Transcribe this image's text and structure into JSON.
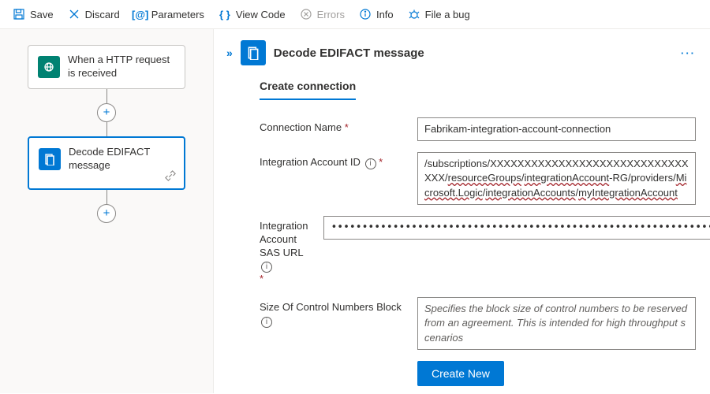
{
  "toolbar": {
    "save": "Save",
    "discard": "Discard",
    "parameters": "Parameters",
    "viewCode": "View Code",
    "errors": "Errors",
    "info": "Info",
    "fileBug": "File a bug"
  },
  "designer": {
    "trigger": {
      "label": "When a HTTP request is received"
    },
    "action": {
      "label": "Decode EDIFACT message"
    }
  },
  "panel": {
    "title": "Decode EDIFACT message",
    "menu": "···",
    "collapse": "»",
    "sectionTitle": "Create connection",
    "fields": {
      "connectionName": {
        "label": "Connection Name",
        "value": "Fabrikam-integration-account-connection"
      },
      "integrationAccountId": {
        "label": "Integration Account ID",
        "value": "/subscriptions/XXXXXXXXXXXXXXXXXXXXXXXXXXXXXXXX/resourceGroups/integrationAccount-RG/providers/Microsoft.Logic/integrationAccounts/myIntegrationAccount"
      },
      "sasUrl": {
        "label": "Integration Account SAS URL",
        "value": "••••••••••••••••••••••••••••••••••••••••••••••••••••••••••••••••••••••••••••••••••••••••••••••••••••••••••••••••••••••••••…"
      },
      "blockSize": {
        "label": "Size Of Control Numbers Block",
        "placeholder": "Specifies the block size of control numbers to be reserved from an agreement. This is intended for high throughput scenarios"
      }
    },
    "createButton": "Create New"
  }
}
